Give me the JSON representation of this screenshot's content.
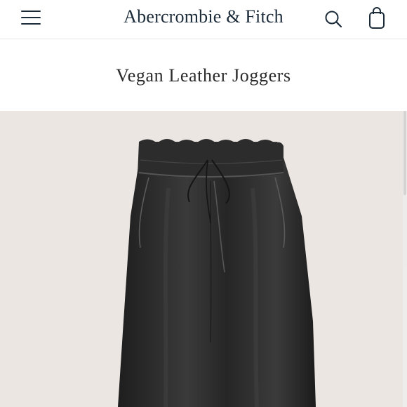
{
  "header": {
    "menu_icon": "hamburger-menu-icon",
    "brand": "Abercrombie & Fitch",
    "search_icon": "search-icon",
    "bag_icon": "shopping-bag-icon"
  },
  "product": {
    "title": "Vegan Leather Joggers",
    "image_alt": "product-image"
  },
  "colors": {
    "brand_navy": "#1c2b39",
    "photo_background": "#ebe6e2",
    "garment": "#2a2a2a"
  }
}
